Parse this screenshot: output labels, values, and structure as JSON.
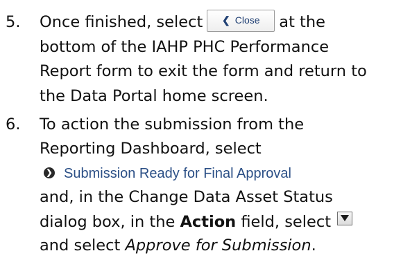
{
  "steps": [
    {
      "number": "5.",
      "text_before": "Once finished, select",
      "button_label": "Close",
      "button_icon": "chevron-left-icon",
      "text_after": "at the",
      "line2": "bottom of the IAHP PHC Performance",
      "line3": "Report form to exit the form and return to",
      "line4": "the Data Portal home screen."
    },
    {
      "number": "6.",
      "line1": "To action the submission from the",
      "line2": "Reporting Dashboard, select",
      "status_link": "Submission Ready for Final Approval",
      "status_icon": "arrow-circle-icon",
      "line4": "and, in the Change Data Asset Status",
      "line5_text": "dialog box, in the",
      "line5_bold": "Action",
      "line5_after": "field, select",
      "dropdown_icon": "dropdown-arrow-icon",
      "line6_text": "and select",
      "line6_italic": "Approve for Submission",
      "line6_end": "."
    }
  ],
  "colors": {
    "text": "#111111",
    "link": "#2b4f86",
    "button_text": "#1f3f73"
  }
}
